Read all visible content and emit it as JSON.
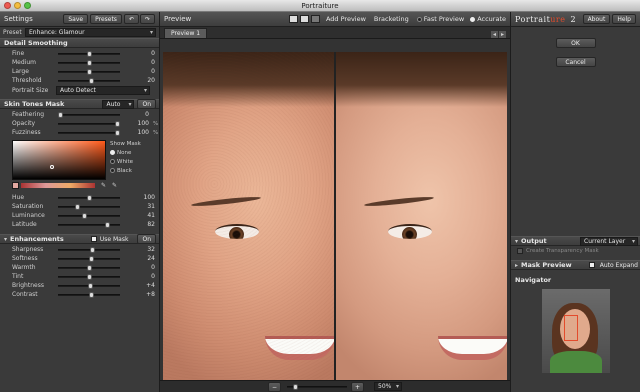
{
  "window": {
    "title": "Portraiture"
  },
  "settings": {
    "title": "Settings",
    "save": "Save",
    "presets": "Presets",
    "preset_label": "Preset",
    "preset_value": "Enhance: Glamour"
  },
  "detail_smoothing": {
    "title": "Detail Smoothing",
    "sliders": [
      {
        "label": "Fine",
        "value": "0",
        "pos": 0.5
      },
      {
        "label": "Medium",
        "value": "0",
        "pos": 0.5
      },
      {
        "label": "Large",
        "value": "0",
        "pos": 0.5
      },
      {
        "label": "Threshold",
        "value": "20",
        "pos": 0.55
      }
    ],
    "portrait_size_label": "Portrait Size",
    "portrait_size_value": "Auto Detect"
  },
  "skin_mask": {
    "title": "Skin Tones Mask",
    "mode": "Auto",
    "toggle": "On",
    "sliders": [
      {
        "label": "Feathering",
        "value": "0",
        "unit": "",
        "pos": 0.0
      },
      {
        "label": "Opacity",
        "value": "100",
        "unit": "%",
        "pos": 1.0
      },
      {
        "label": "Fuzziness",
        "value": "100",
        "unit": "%",
        "pos": 1.0
      }
    ],
    "show_mask_label": "Show Mask",
    "show_mask_options": [
      "None",
      "White",
      "Black"
    ],
    "hsl": [
      {
        "label": "Hue",
        "value": "100",
        "pos": 0.5
      },
      {
        "label": "Saturation",
        "value": "31",
        "pos": 0.3
      },
      {
        "label": "Luminance",
        "value": "41",
        "pos": 0.42
      },
      {
        "label": "Latitude",
        "value": "82",
        "pos": 0.82
      }
    ]
  },
  "enhancements": {
    "title": "Enhancements",
    "use_mask": "Use Mask",
    "toggle": "On",
    "sliders": [
      {
        "label": "Sharpness",
        "value": "32",
        "pos": 0.56
      },
      {
        "label": "Softness",
        "value": "24",
        "pos": 0.54
      },
      {
        "label": "Warmth",
        "value": "0",
        "pos": 0.5
      },
      {
        "label": "Tint",
        "value": "0",
        "pos": 0.5
      },
      {
        "label": "Brightness",
        "value": "+4",
        "pos": 0.52
      },
      {
        "label": "Contrast",
        "value": "+8",
        "pos": 0.55
      }
    ]
  },
  "preview": {
    "title": "Preview",
    "tab": "Preview 1",
    "add_preview": "Add Preview",
    "bracketing": "Bracketing",
    "fast_preview": "Fast Preview",
    "accurate": "Accurate",
    "zoom": "50%"
  },
  "brand": {
    "name_prefix": "Portrait",
    "name_suffix": "ure",
    "version": "2",
    "about": "About",
    "help": "Help"
  },
  "actions": {
    "ok": "OK",
    "cancel": "Cancel"
  },
  "output": {
    "title": "Output",
    "value": "Current Layer",
    "create_mask": "Create Transparency Mask"
  },
  "mask_preview": {
    "title": "Mask Preview",
    "auto_expand": "Auto Expand"
  },
  "navigator": {
    "title": "Navigator"
  },
  "colors": {
    "accent": "#e34b2c",
    "panel": "#3a3a3a"
  }
}
